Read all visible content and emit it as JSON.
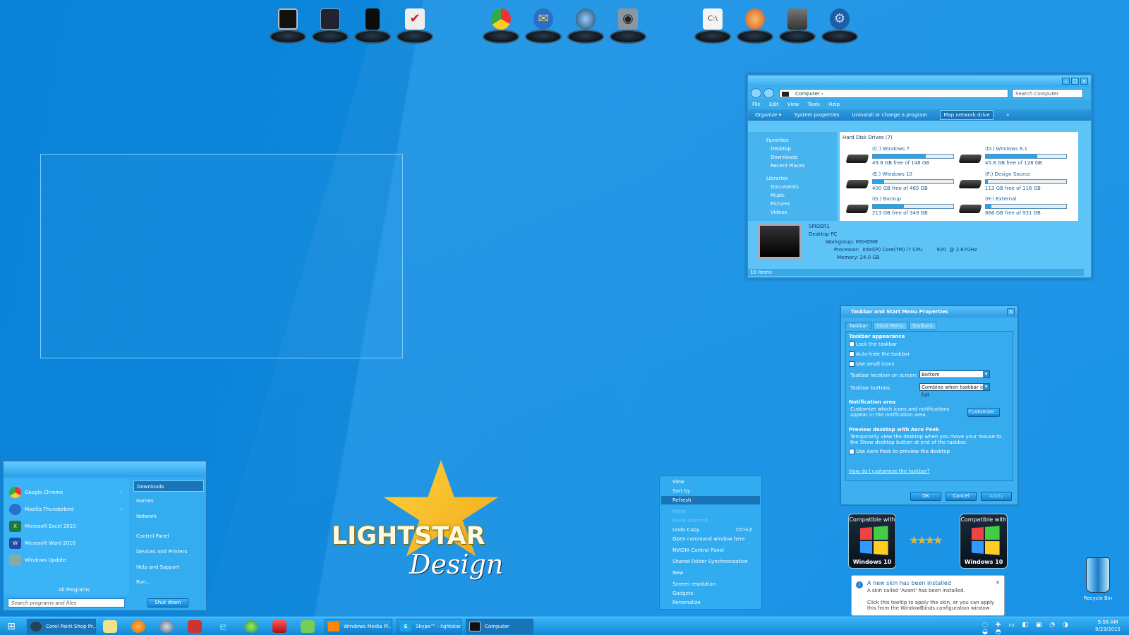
{
  "dock": {
    "icons": [
      "monitor-icon",
      "media-player-icon",
      "pc-tower-icon",
      "checklist-icon",
      "chrome-icon",
      "thunderbird-icon",
      "google-earth-icon",
      "camera-icon",
      "cnet-document-icon",
      "media-center-icon",
      "server-icon",
      "settings-icon"
    ]
  },
  "explorer": {
    "address": "Computer",
    "search_placeholder": "Search Computer",
    "menu": [
      "File",
      "Edit",
      "View",
      "Tools",
      "Help"
    ],
    "commands": [
      "Organize ▾",
      "System properties",
      "Uninstall or change a program",
      "Map network drive",
      "»"
    ],
    "nav": {
      "favorites": "Favorites",
      "fav_items": [
        "Desktop",
        "Downloads",
        "Recent Places"
      ],
      "libraries": "Libraries",
      "lib_items": [
        "Documents",
        "Music",
        "Pictures",
        "Videos"
      ]
    },
    "group_header": "Hard Disk Drives (7)",
    "drives": [
      {
        "name": "(C:) Windows 7",
        "free": "49.8 GB free of 148 GB",
        "used": 0.66
      },
      {
        "name": "(D:) Windows 8.1",
        "free": "45.8 GB free of 128 GB",
        "used": 0.64
      },
      {
        "name": "(E:) Windows 10",
        "free": "400 GB free of 465 GB",
        "used": 0.14
      },
      {
        "name": "(F:) Design Source",
        "free": "113 GB free of 116 GB",
        "used": 0.03
      },
      {
        "name": "(G:) Backup",
        "free": "213 GB free of 349 GB",
        "used": 0.39
      },
      {
        "name": "(H:) External",
        "free": "866 GB free of 931 GB",
        "used": 0.07
      }
    ],
    "details": {
      "name": "SPIDER1",
      "type": "Desktop PC",
      "workgroup": "Workgroup:  MSHOME",
      "processor": "Processor:  Intel(R) Core(TM) i7 CPU         920  @ 2.67GHz",
      "memory": "Memory:  24.0 GB"
    },
    "status": "10 items"
  },
  "dialog": {
    "title": "Taskbar and Start Menu Properties",
    "tabs": [
      "Taskbar",
      "Start Menu",
      "Toolbars"
    ],
    "appearance": "Taskbar appearance",
    "lock": "Lock the taskbar",
    "autohide": "Auto-hide the taskbar",
    "small_icons": "Use small icons",
    "location_label": "Taskbar location on screen:",
    "location_value": "Bottom",
    "buttons_label": "Taskbar buttons:",
    "buttons_value": "Combine when taskbar is full",
    "notif_head": "Notification area",
    "notif_text": "Customize which icons and notifications appear in the notification area.",
    "customize": "Customize...",
    "peek_head": "Preview desktop with Aero Peek",
    "peek_text": "Temporarily view the desktop when you move your mouse to the Show desktop button at end of the taskbar.",
    "peek_check": "Use Aero Peek to preview the desktop",
    "help_link": "How do I customize the taskbar?",
    "ok": "OK",
    "cancel": "Cancel",
    "apply": "Apply"
  },
  "start_menu": {
    "programs": [
      "Google Chrome",
      "Mozilla Thunderbird",
      "Microsoft Excel 2010",
      "Microsoft Word 2010",
      "Windows Update"
    ],
    "all_programs": "All Programs",
    "search_placeholder": "Search programs and files",
    "shutdown": "Shut down",
    "right": [
      "Downloads",
      "Games",
      "Network",
      "Control Panel",
      "Devices and Printers",
      "Help and Support",
      "Run..."
    ]
  },
  "logo": {
    "line1": "LIGHTSTAR",
    "line2": "Design"
  },
  "context_menu": {
    "items": [
      "View",
      "Sort by",
      "Refresh",
      "Paste",
      "Paste shortcut",
      "Undo Copy",
      "Open command window here",
      "NVIDIA Control Panel",
      "Shared Folder Synchronization",
      "New",
      "Screen resolution",
      "Gadgets",
      "Personalize"
    ],
    "shortcut": "Ctrl+Z"
  },
  "badges": {
    "compat": "Compatible with",
    "os": "Windows 10"
  },
  "toast": {
    "title": "A new skin has been installed",
    "sub": "A skin called 'Avant' has been installed.",
    "body": "Click this tooltip to apply the skin, or you can apply this from the WindowBlinds configuration window"
  },
  "recycle_bin": "Recycle Bin",
  "taskbar": {
    "tasks": [
      "Corel Paint Shop Pr...",
      "Windows Media Pl...",
      "Skype™ - lightstar...",
      "Computer"
    ],
    "time": "9:56 AM",
    "date": "9/23/2015"
  },
  "colors": {
    "accent": "#1a8fe0",
    "highlight": "#0d6fb5"
  }
}
